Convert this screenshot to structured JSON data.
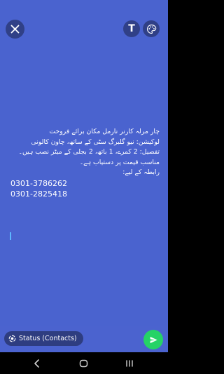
{
  "toolbar": {
    "close_icon": "close-icon",
    "text_tool_label": "T",
    "palette_icon": "palette-icon"
  },
  "message": {
    "lines": [
      "چار مرلہ کارنر نارمل مکان برائے فروخت",
      "لوکیشن: نیو گلبرگ سٹی کے ساتھ، چاون کالونی",
      "تفصیل: 2 کمرے، 1 باتھ، 2 بجلی کے میٹر نصب ہیں۔",
      "مناسب قیمت پر دستیاب ہے۔",
      "رابطہ کے لیے:"
    ],
    "phones": [
      "0301-3786262",
      "0301-2825418"
    ]
  },
  "footer": {
    "audience_label": "Status (Contacts)",
    "send_icon": "send-icon"
  },
  "colors": {
    "background": "#4a63cf",
    "send_button": "#25d366"
  }
}
